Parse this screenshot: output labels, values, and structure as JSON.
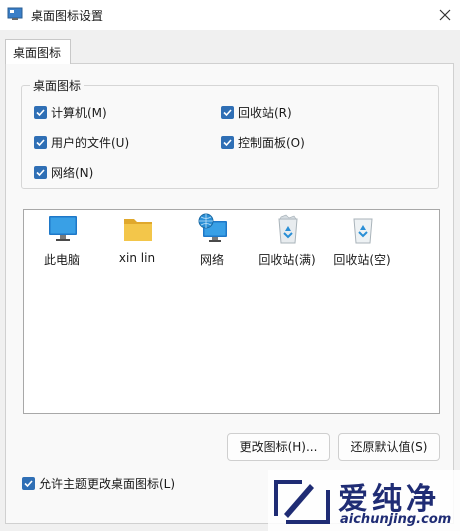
{
  "window": {
    "title": "桌面图标设置"
  },
  "tab": {
    "label": "桌面图标"
  },
  "group": {
    "title": "桌面图标",
    "checkboxes": [
      {
        "label": "计算机(M)",
        "checked": true
      },
      {
        "label": "回收站(R)",
        "checked": true
      },
      {
        "label": "用户的文件(U)",
        "checked": true
      },
      {
        "label": "控制面板(O)",
        "checked": true
      },
      {
        "label": "网络(N)",
        "checked": true
      }
    ]
  },
  "icons": [
    {
      "label": "此电脑",
      "icon": "monitor-icon"
    },
    {
      "label": "xin lin",
      "icon": "folder-icon"
    },
    {
      "label": "网络",
      "icon": "network-globe-icon"
    },
    {
      "label": "回收站(满)",
      "icon": "recycle-bin-full-icon"
    },
    {
      "label": "回收站(空)",
      "icon": "recycle-bin-empty-icon"
    }
  ],
  "buttons": {
    "change_icon": "更改图标(H)...",
    "restore_default": "还原默认值(S)"
  },
  "allow_themes": {
    "label": "允许主题更改桌面图标(L)",
    "checked": true
  },
  "watermark": {
    "brand": "爱纯净",
    "url": "aichunjing.com"
  },
  "colors": {
    "accent": "#2f6fb5",
    "folder": "#f3c64a",
    "monitor": "#1e78c8"
  }
}
